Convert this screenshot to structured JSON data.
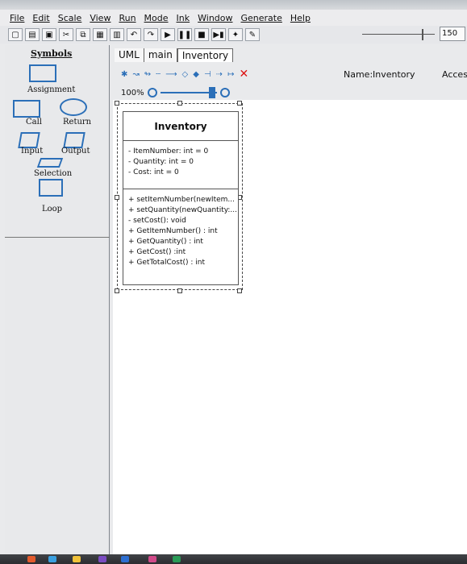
{
  "menu": [
    "File",
    "Edit",
    "Scale",
    "View",
    "Run",
    "Mode",
    "Ink",
    "Window",
    "Generate",
    "Help"
  ],
  "speed": {
    "value_label": "150",
    "level": 0.82
  },
  "symbols": {
    "title": "Symbols",
    "items": [
      {
        "label": "Assignment"
      },
      {
        "label": "Call"
      },
      {
        "label": "Return"
      },
      {
        "label": "Input"
      },
      {
        "label": "Output"
      },
      {
        "label": "Selection"
      },
      {
        "label": "Loop"
      }
    ]
  },
  "tabs": [
    {
      "label": "UML"
    },
    {
      "label": "main"
    },
    {
      "label": "Inventory"
    }
  ],
  "uml_toolbar": {
    "name_label": "Name:",
    "name_value": "Inventory",
    "access_label": "Access"
  },
  "zoom": {
    "percent": "100%"
  },
  "uml_class": {
    "name": "Inventory",
    "attributes": [
      "- ItemNumber: int = 0",
      "- Quantity: int = 0",
      "- Cost: int = 0"
    ],
    "methods": [
      "+ setItemNumber(newItem...",
      "+ setQuantity(newQuantity:...",
      "- setCost(): void",
      "+ GetItemNumber() : int",
      "+ GetQuantity() : int",
      "+ GetCost() :int",
      "+ GetTotalCost() : int"
    ]
  }
}
